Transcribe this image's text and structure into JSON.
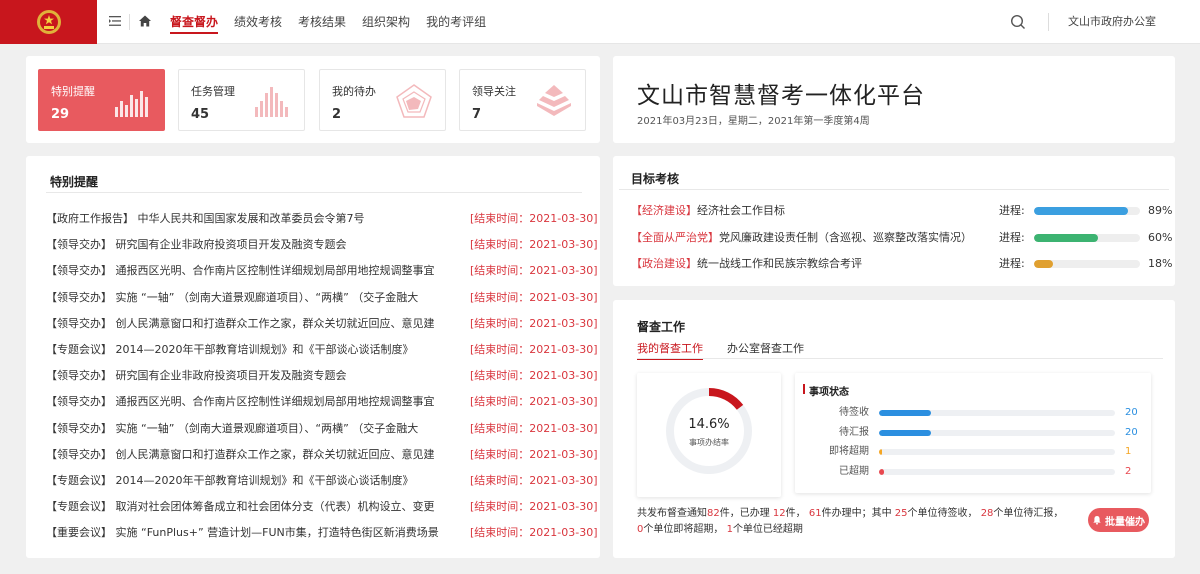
{
  "header": {
    "nav": [
      "督查督办",
      "绩效考核",
      "考核结果",
      "组织架构",
      "我的考评组"
    ],
    "org_name": "文山市政府办公室"
  },
  "stats": [
    {
      "label": "特别提醒",
      "value": "29",
      "icon": "bar-chart-icon"
    },
    {
      "label": "任务管理",
      "value": "45",
      "icon": "bar-chart-icon"
    },
    {
      "label": "我的待办",
      "value": "2",
      "icon": "radar-chart-icon"
    },
    {
      "label": "领导关注",
      "value": "7",
      "icon": "pyramid-icon"
    }
  ],
  "platform": {
    "title": "文山市智慧督考一体化平台",
    "date_line": "2021年03月23日，星期二，2021年第一季度第4周"
  },
  "reminders": {
    "title": "特别提醒",
    "items": [
      {
        "text": "【政府工作报告】 中华人民共和国国家发展和改革委员会令第7号",
        "date": "[结束时间：2021-03-30]"
      },
      {
        "text": "【领导交办】 研究国有企业非政府投资项目开发及融资专题会",
        "date": "[结束时间：2021-03-30]"
      },
      {
        "text": "【领导交办】 通报西区光明、合作南片区控制性详细规划局部用地控规调整事宜",
        "date": "[结束时间：2021-03-30]"
      },
      {
        "text": "【领导交办】 实施 “一轴” （剑南大道景观廊道项目）、“两横” （交子金融大",
        "date": "[结束时间：2021-03-30]"
      },
      {
        "text": "【领导交办】 创人民满意窗口和打造群众工作之家，群众关切就近回应、意见建",
        "date": "[结束时间：2021-03-30]"
      },
      {
        "text": "【专题会议】 2014—2020年干部教育培训规划》和《干部谈心谈话制度》",
        "date": "[结束时间：2021-03-30]"
      },
      {
        "text": "【领导交办】 研究国有企业非政府投资项目开发及融资专题会",
        "date": "[结束时间：2021-03-30]"
      },
      {
        "text": "【领导交办】 通报西区光明、合作南片区控制性详细规划局部用地控规调整事宜",
        "date": "[结束时间：2021-03-30]"
      },
      {
        "text": "【领导交办】 实施 “一轴” （剑南大道景观廊道项目）、“两横” （交子金融大",
        "date": "[结束时间：2021-03-30]"
      },
      {
        "text": "【领导交办】 创人民满意窗口和打造群众工作之家，群众关切就近回应、意见建",
        "date": "[结束时间：2021-03-30]"
      },
      {
        "text": "【专题会议】 2014—2020年干部教育培训规划》和《干部谈心谈话制度》",
        "date": "[结束时间：2021-03-30]"
      },
      {
        "text": "【专题会议】 取消对社会团体筹备成立和社会团体分支（代表）机构设立、变更",
        "date": "[结束时间：2021-03-30]"
      },
      {
        "text": "【重要会议】 实施 “FunPlus+” 营造计划—FUN市集，打造特色街区新消费场景",
        "date": "[结束时间：2021-03-30]"
      }
    ]
  },
  "targets": {
    "title": "目标考核",
    "progress_label": "进程:",
    "items": [
      {
        "tag": "【经济建设】",
        "name": "经济社会工作目标",
        "percent": 89,
        "pct_text": "89%",
        "color": "#3b9fe0"
      },
      {
        "tag": "【全面从严治党】",
        "name": "党风廉政建设责任制（含巡视、巡察整改落实情况）",
        "percent": 60,
        "pct_text": "60%",
        "color": "#3cb371"
      },
      {
        "tag": "【政治建设】",
        "name": "统一战线工作和民族宗教综合考评",
        "percent": 18,
        "pct_text": "18%",
        "color": "#e0a030"
      }
    ]
  },
  "supervise": {
    "title": "督查工作",
    "tabs": [
      "我的督查工作",
      "办公室督查工作"
    ],
    "rate": 14.6,
    "rate_text": "14.6%",
    "rate_label": "事项办结率",
    "status_title": "事项状态",
    "status": [
      {
        "label": "待签收",
        "value": 20,
        "value_text": "20",
        "fill": 0.22,
        "bar_color": "#2b8fe0",
        "value_color": "#2b8fe0"
      },
      {
        "label": "待汇报",
        "value": 20,
        "value_text": "20",
        "fill": 0.22,
        "bar_color": "#2b8fe0",
        "value_color": "#2b8fe0"
      },
      {
        "label": "即将超期",
        "value": 1,
        "value_text": "1",
        "fill": 0.01,
        "bar_color": "#f5a623",
        "value_color": "#f5a623"
      },
      {
        "label": "已超期",
        "value": 2,
        "value_text": "2",
        "fill": 0.02,
        "bar_color": "#e8484f",
        "value_color": "#e8484f"
      }
    ],
    "summary": {
      "p1": "共发布督查通知",
      "n1": "82",
      "p2": "件，已办理 ",
      "n2": "12",
      "p3": "件，",
      "n3": "61",
      "p4": "件办理中；其中 ",
      "n4": "25",
      "p5": "个单位待签收，",
      "n5": "28",
      "p6": "个单位待汇报，",
      "n6": "0",
      "p7": "个单位即将超期，",
      "n7": "1",
      "p8": "个单位已经超期"
    },
    "urge_button": "批量催办"
  },
  "colors": {
    "brand": "#c8161d",
    "accent": "#e85a5f",
    "danger": "#d9363e"
  }
}
